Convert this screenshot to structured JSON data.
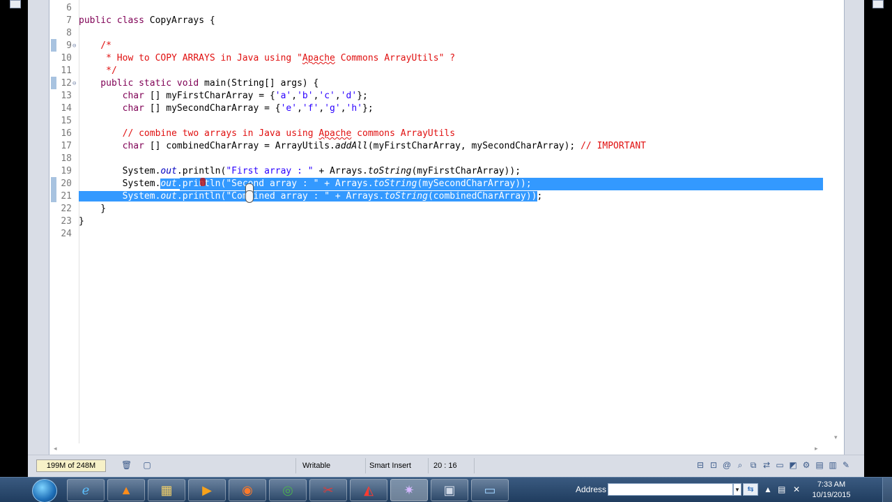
{
  "editor": {
    "lines": [
      {
        "num": "6",
        "fold": "",
        "tokens": [
          {
            "t": "",
            "c": ""
          }
        ]
      },
      {
        "num": "7",
        "fold": "",
        "tokens": [
          {
            "t": "public class",
            "c": "kw"
          },
          {
            "t": " CopyArrays {",
            "c": ""
          }
        ]
      },
      {
        "num": "8",
        "fold": "",
        "tokens": [
          {
            "t": "",
            "c": ""
          }
        ]
      },
      {
        "num": "9",
        "fold": "⊖",
        "tokens": [
          {
            "t": "    /*",
            "c": "cm"
          }
        ]
      },
      {
        "num": "10",
        "fold": "",
        "tokens": [
          {
            "t": "     * How to COPY ARRAYS in Java using \"",
            "c": "cm"
          },
          {
            "t": "Apache",
            "c": "cm squig"
          },
          {
            "t": " Commons ArrayUtils\" ?",
            "c": "cm"
          }
        ]
      },
      {
        "num": "11",
        "fold": "",
        "tokens": [
          {
            "t": "     */",
            "c": "cm"
          }
        ]
      },
      {
        "num": "12",
        "fold": "⊖",
        "tokens": [
          {
            "t": "    public static void",
            "c": "kw"
          },
          {
            "t": " main(String[] args) {",
            "c": ""
          }
        ]
      },
      {
        "num": "13",
        "fold": "",
        "tokens": [
          {
            "t": "        ",
            "c": ""
          },
          {
            "t": "char",
            "c": "kw"
          },
          {
            "t": " [] myFirstCharArray = {",
            "c": ""
          },
          {
            "t": "'a'",
            "c": "st"
          },
          {
            "t": ",",
            "c": ""
          },
          {
            "t": "'b'",
            "c": "st"
          },
          {
            "t": ",",
            "c": ""
          },
          {
            "t": "'c'",
            "c": "st"
          },
          {
            "t": ",",
            "c": ""
          },
          {
            "t": "'d'",
            "c": "st"
          },
          {
            "t": "};",
            "c": ""
          }
        ]
      },
      {
        "num": "14",
        "fold": "",
        "tokens": [
          {
            "t": "        ",
            "c": ""
          },
          {
            "t": "char",
            "c": "kw"
          },
          {
            "t": " [] mySecondCharArray = {",
            "c": ""
          },
          {
            "t": "'e'",
            "c": "st"
          },
          {
            "t": ",",
            "c": ""
          },
          {
            "t": "'f'",
            "c": "st"
          },
          {
            "t": ",",
            "c": ""
          },
          {
            "t": "'g'",
            "c": "st"
          },
          {
            "t": ",",
            "c": ""
          },
          {
            "t": "'h'",
            "c": "st"
          },
          {
            "t": "};",
            "c": ""
          }
        ]
      },
      {
        "num": "15",
        "fold": "",
        "tokens": [
          {
            "t": "",
            "c": ""
          }
        ]
      },
      {
        "num": "16",
        "fold": "",
        "tokens": [
          {
            "t": "        // combine two arrays in Java using ",
            "c": "cm"
          },
          {
            "t": "Apache",
            "c": "cm squig"
          },
          {
            "t": " commons ArrayUtils",
            "c": "cm"
          }
        ]
      },
      {
        "num": "17",
        "fold": "",
        "tokens": [
          {
            "t": "        ",
            "c": ""
          },
          {
            "t": "char",
            "c": "kw"
          },
          {
            "t": " [] combinedCharArray = ArrayUtils.",
            "c": ""
          },
          {
            "t": "addAll",
            "c": "it"
          },
          {
            "t": "(myFirstCharArray, mySecondCharArray); ",
            "c": ""
          },
          {
            "t": "// IMPORTANT",
            "c": "cm"
          }
        ]
      },
      {
        "num": "18",
        "fold": "",
        "tokens": [
          {
            "t": "",
            "c": ""
          }
        ]
      },
      {
        "num": "19",
        "fold": "",
        "tokens": [
          {
            "t": "        System.",
            "c": ""
          },
          {
            "t": "out",
            "c": "fld"
          },
          {
            "t": ".println(",
            "c": ""
          },
          {
            "t": "\"First array : \"",
            "c": "st"
          },
          {
            "t": " + Arrays.",
            "c": ""
          },
          {
            "t": "toString",
            "c": "it"
          },
          {
            "t": "(myFirstCharArray));",
            "c": ""
          }
        ]
      },
      {
        "num": "20",
        "fold": "",
        "tokens": [
          {
            "t": "        System.",
            "c": ""
          },
          {
            "t": "out",
            "c": "fld"
          },
          {
            "t": ".println(",
            "c": ""
          },
          {
            "t": "\"Second array : \"",
            "c": "st"
          },
          {
            "t": " + Arrays.",
            "c": ""
          },
          {
            "t": "toString",
            "c": "it"
          },
          {
            "t": "(mySecondCharArray));",
            "c": ""
          }
        ]
      },
      {
        "num": "21",
        "fold": "",
        "tokens": [
          {
            "t": "        System.",
            "c": ""
          },
          {
            "t": "out",
            "c": "fld"
          },
          {
            "t": ".println(",
            "c": ""
          },
          {
            "t": "\"Combined array : \"",
            "c": "st"
          },
          {
            "t": " + Arrays.",
            "c": ""
          },
          {
            "t": "toString",
            "c": "it"
          },
          {
            "t": "(combinedCharArray))",
            "c": ""
          },
          {
            "t": ";",
            "c": ""
          }
        ]
      },
      {
        "num": "22",
        "fold": "",
        "tokens": [
          {
            "t": "    }",
            "c": ""
          }
        ]
      },
      {
        "num": "23",
        "fold": "",
        "tokens": [
          {
            "t": "}",
            "c": ""
          }
        ]
      },
      {
        "num": "24",
        "fold": "",
        "tokens": [
          {
            "t": "",
            "c": ""
          }
        ]
      }
    ]
  },
  "statusbar": {
    "heap": "199M of 248M",
    "writable": "Writable",
    "insert_mode": "Smart Insert",
    "position": "20 : 16"
  },
  "taskbar": {
    "address_label": "Address",
    "address_value": "",
    "clock_time": "7:33 AM",
    "clock_date": "10/19/2015"
  },
  "colors": {
    "keyword": "#7f0055",
    "comment": "#e01010",
    "string": "#2a00ff",
    "selection": "#3399ff",
    "field": "#0000c0"
  },
  "icons": {
    "start": "windows-orb-icon",
    "tasks": [
      "ie-icon",
      "vlc-icon",
      "explorer-icon",
      "media-player-icon",
      "firefox-icon",
      "chrome-icon",
      "snipping-icon",
      "acrobat-icon",
      "eclipse-icon",
      "save-icon",
      "screen-icon"
    ]
  }
}
